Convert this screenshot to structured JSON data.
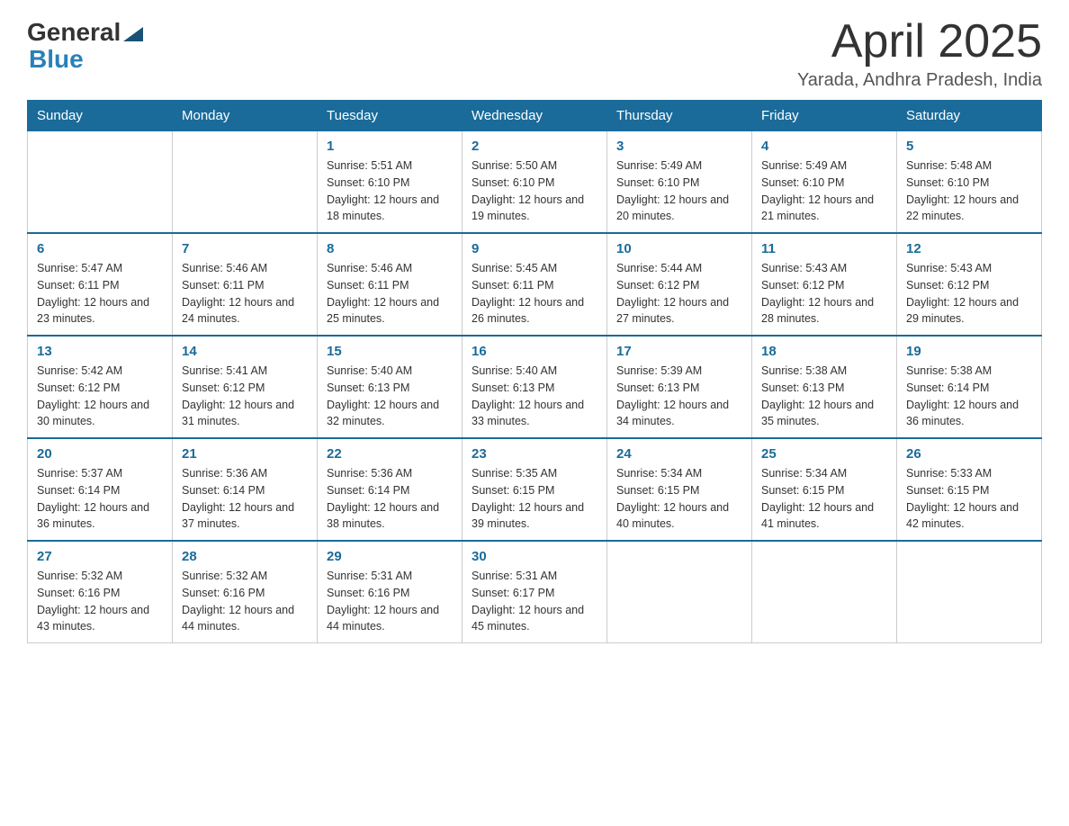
{
  "header": {
    "logo": {
      "general": "General",
      "blue": "Blue",
      "arrow": "▲"
    },
    "title": "April 2025",
    "subtitle": "Yarada, Andhra Pradesh, India"
  },
  "calendar": {
    "days_of_week": [
      "Sunday",
      "Monday",
      "Tuesday",
      "Wednesday",
      "Thursday",
      "Friday",
      "Saturday"
    ],
    "weeks": [
      [
        {
          "day": "",
          "sunrise": "",
          "sunset": "",
          "daylight": ""
        },
        {
          "day": "",
          "sunrise": "",
          "sunset": "",
          "daylight": ""
        },
        {
          "day": "1",
          "sunrise": "Sunrise: 5:51 AM",
          "sunset": "Sunset: 6:10 PM",
          "daylight": "Daylight: 12 hours and 18 minutes."
        },
        {
          "day": "2",
          "sunrise": "Sunrise: 5:50 AM",
          "sunset": "Sunset: 6:10 PM",
          "daylight": "Daylight: 12 hours and 19 minutes."
        },
        {
          "day": "3",
          "sunrise": "Sunrise: 5:49 AM",
          "sunset": "Sunset: 6:10 PM",
          "daylight": "Daylight: 12 hours and 20 minutes."
        },
        {
          "day": "4",
          "sunrise": "Sunrise: 5:49 AM",
          "sunset": "Sunset: 6:10 PM",
          "daylight": "Daylight: 12 hours and 21 minutes."
        },
        {
          "day": "5",
          "sunrise": "Sunrise: 5:48 AM",
          "sunset": "Sunset: 6:10 PM",
          "daylight": "Daylight: 12 hours and 22 minutes."
        }
      ],
      [
        {
          "day": "6",
          "sunrise": "Sunrise: 5:47 AM",
          "sunset": "Sunset: 6:11 PM",
          "daylight": "Daylight: 12 hours and 23 minutes."
        },
        {
          "day": "7",
          "sunrise": "Sunrise: 5:46 AM",
          "sunset": "Sunset: 6:11 PM",
          "daylight": "Daylight: 12 hours and 24 minutes."
        },
        {
          "day": "8",
          "sunrise": "Sunrise: 5:46 AM",
          "sunset": "Sunset: 6:11 PM",
          "daylight": "Daylight: 12 hours and 25 minutes."
        },
        {
          "day": "9",
          "sunrise": "Sunrise: 5:45 AM",
          "sunset": "Sunset: 6:11 PM",
          "daylight": "Daylight: 12 hours and 26 minutes."
        },
        {
          "day": "10",
          "sunrise": "Sunrise: 5:44 AM",
          "sunset": "Sunset: 6:12 PM",
          "daylight": "Daylight: 12 hours and 27 minutes."
        },
        {
          "day": "11",
          "sunrise": "Sunrise: 5:43 AM",
          "sunset": "Sunset: 6:12 PM",
          "daylight": "Daylight: 12 hours and 28 minutes."
        },
        {
          "day": "12",
          "sunrise": "Sunrise: 5:43 AM",
          "sunset": "Sunset: 6:12 PM",
          "daylight": "Daylight: 12 hours and 29 minutes."
        }
      ],
      [
        {
          "day": "13",
          "sunrise": "Sunrise: 5:42 AM",
          "sunset": "Sunset: 6:12 PM",
          "daylight": "Daylight: 12 hours and 30 minutes."
        },
        {
          "day": "14",
          "sunrise": "Sunrise: 5:41 AM",
          "sunset": "Sunset: 6:12 PM",
          "daylight": "Daylight: 12 hours and 31 minutes."
        },
        {
          "day": "15",
          "sunrise": "Sunrise: 5:40 AM",
          "sunset": "Sunset: 6:13 PM",
          "daylight": "Daylight: 12 hours and 32 minutes."
        },
        {
          "day": "16",
          "sunrise": "Sunrise: 5:40 AM",
          "sunset": "Sunset: 6:13 PM",
          "daylight": "Daylight: 12 hours and 33 minutes."
        },
        {
          "day": "17",
          "sunrise": "Sunrise: 5:39 AM",
          "sunset": "Sunset: 6:13 PM",
          "daylight": "Daylight: 12 hours and 34 minutes."
        },
        {
          "day": "18",
          "sunrise": "Sunrise: 5:38 AM",
          "sunset": "Sunset: 6:13 PM",
          "daylight": "Daylight: 12 hours and 35 minutes."
        },
        {
          "day": "19",
          "sunrise": "Sunrise: 5:38 AM",
          "sunset": "Sunset: 6:14 PM",
          "daylight": "Daylight: 12 hours and 36 minutes."
        }
      ],
      [
        {
          "day": "20",
          "sunrise": "Sunrise: 5:37 AM",
          "sunset": "Sunset: 6:14 PM",
          "daylight": "Daylight: 12 hours and 36 minutes."
        },
        {
          "day": "21",
          "sunrise": "Sunrise: 5:36 AM",
          "sunset": "Sunset: 6:14 PM",
          "daylight": "Daylight: 12 hours and 37 minutes."
        },
        {
          "day": "22",
          "sunrise": "Sunrise: 5:36 AM",
          "sunset": "Sunset: 6:14 PM",
          "daylight": "Daylight: 12 hours and 38 minutes."
        },
        {
          "day": "23",
          "sunrise": "Sunrise: 5:35 AM",
          "sunset": "Sunset: 6:15 PM",
          "daylight": "Daylight: 12 hours and 39 minutes."
        },
        {
          "day": "24",
          "sunrise": "Sunrise: 5:34 AM",
          "sunset": "Sunset: 6:15 PM",
          "daylight": "Daylight: 12 hours and 40 minutes."
        },
        {
          "day": "25",
          "sunrise": "Sunrise: 5:34 AM",
          "sunset": "Sunset: 6:15 PM",
          "daylight": "Daylight: 12 hours and 41 minutes."
        },
        {
          "day": "26",
          "sunrise": "Sunrise: 5:33 AM",
          "sunset": "Sunset: 6:15 PM",
          "daylight": "Daylight: 12 hours and 42 minutes."
        }
      ],
      [
        {
          "day": "27",
          "sunrise": "Sunrise: 5:32 AM",
          "sunset": "Sunset: 6:16 PM",
          "daylight": "Daylight: 12 hours and 43 minutes."
        },
        {
          "day": "28",
          "sunrise": "Sunrise: 5:32 AM",
          "sunset": "Sunset: 6:16 PM",
          "daylight": "Daylight: 12 hours and 44 minutes."
        },
        {
          "day": "29",
          "sunrise": "Sunrise: 5:31 AM",
          "sunset": "Sunset: 6:16 PM",
          "daylight": "Daylight: 12 hours and 44 minutes."
        },
        {
          "day": "30",
          "sunrise": "Sunrise: 5:31 AM",
          "sunset": "Sunset: 6:17 PM",
          "daylight": "Daylight: 12 hours and 45 minutes."
        },
        {
          "day": "",
          "sunrise": "",
          "sunset": "",
          "daylight": ""
        },
        {
          "day": "",
          "sunrise": "",
          "sunset": "",
          "daylight": ""
        },
        {
          "day": "",
          "sunrise": "",
          "sunset": "",
          "daylight": ""
        }
      ]
    ]
  }
}
